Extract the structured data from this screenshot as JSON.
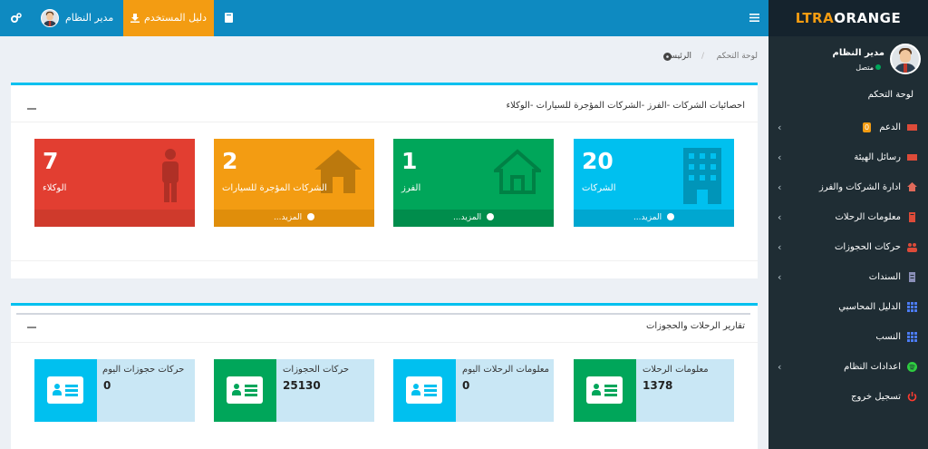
{
  "colors": {
    "header": "#0e8ac1",
    "sidebar": "#1f2d34",
    "accent_blue": "#00c0ef",
    "aqua": "#00c0ef",
    "green": "#00a65a",
    "orange": "#f39c12",
    "red": "#dd4b39"
  },
  "logo": {
    "part1": "LTRA",
    "part2": "ORANGE"
  },
  "topbar": {
    "menu_icon": "hamburger-icon",
    "book_icon": "book-icon",
    "user_guide_label": "دليل المستخدم",
    "user_guide_icon": "download-icon",
    "user_name": "مدير النظام",
    "settings_icon": "cogs-icon"
  },
  "sidebar": {
    "user_name": "مدير النظام",
    "status": "متصل",
    "header_label": "لوحة التحكم",
    "items": [
      {
        "label": "الدعم",
        "icon": "envelope-icon",
        "badge": "0",
        "chevron": true
      },
      {
        "label": "رسائل الهيئة",
        "icon": "envelope-icon",
        "chevron": true
      },
      {
        "label": "ادارة الشركات والفرز",
        "icon": "home-icon",
        "chevron": true
      },
      {
        "label": "معلومات الرحلات",
        "icon": "book-icon",
        "chevron": true
      },
      {
        "label": "حركات الحجوزات",
        "icon": "users-icon",
        "chevron": true
      },
      {
        "label": "السندات",
        "icon": "file-icon",
        "chevron": true
      },
      {
        "label": "الدليل المحاسبي",
        "icon": "grid-icon",
        "chevron": false
      },
      {
        "label": "النسب",
        "icon": "grid-icon",
        "chevron": false
      },
      {
        "label": "اعدادات النظام",
        "icon": "spotify-icon",
        "chevron": true
      },
      {
        "label": "تسجيل خروج",
        "icon": "power-icon",
        "chevron": false
      }
    ]
  },
  "breadcrumb": {
    "home": "الرئيسية",
    "current": "لوحة التحكم",
    "separator": "/",
    "home_icon": "dashboard-icon"
  },
  "stats_box": {
    "title": "احصائيات الشركات -الفرز -الشركات المؤجرة للسيارات -الوكلاء",
    "cards": [
      {
        "value": "20",
        "label": "الشركات",
        "footer": "المزيد...",
        "icon": "building-icon",
        "color": "#00c0ef",
        "footer_color": "#00a7d0"
      },
      {
        "value": "1",
        "label": "الفرز",
        "footer": "المزيد...",
        "icon": "home-outline-icon",
        "color": "#00a65a",
        "footer_color": "#008d4c"
      },
      {
        "value": "2",
        "label": "الشركات المؤجرة للسيارات",
        "footer": "المزيد...",
        "icon": "home-icon",
        "color": "#f39c12",
        "footer_color": "#e08e0b"
      },
      {
        "value": "7",
        "label": "الوكلاء",
        "footer": "",
        "icon": "person-icon",
        "color": "#e23e31",
        "footer_color": "#cf3a2c"
      }
    ]
  },
  "reports_box": {
    "title": "تقارير الرحلات والحجوزات",
    "cards": [
      {
        "label": "معلومات الرحلات",
        "value": "1378",
        "icon": "id-card-icon",
        "color": "#00a65a"
      },
      {
        "label": "معلومات الرحلات اليوم",
        "value": "0",
        "icon": "id-card-icon",
        "color": "#00c0ef"
      },
      {
        "label": "حركات الحجوزات",
        "value": "25130",
        "icon": "id-card-icon",
        "color": "#00a65a"
      },
      {
        "label": "حركات حجوزات اليوم",
        "value": "0",
        "icon": "id-card-icon",
        "color": "#00c0ef"
      }
    ]
  }
}
